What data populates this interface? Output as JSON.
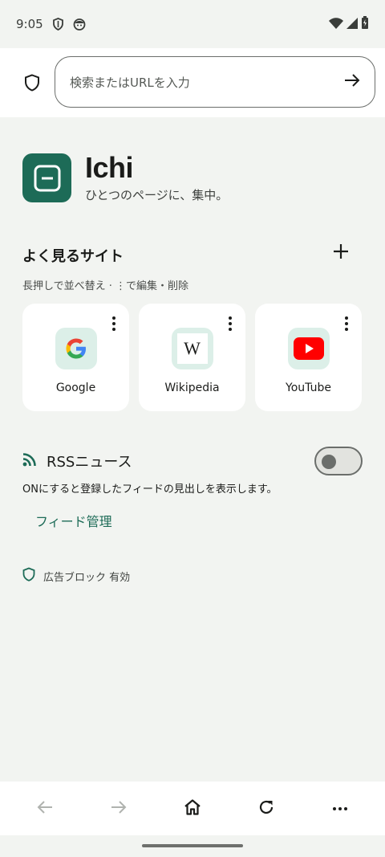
{
  "status": {
    "time": "9:05",
    "icons": [
      "shield-status-icon",
      "face-status-icon",
      "wifi-icon",
      "cell-signal-icon",
      "battery-icon"
    ]
  },
  "toolbar": {
    "search_placeholder": "検索またはURLを入力",
    "shield_icon": "shield-icon",
    "go_icon": "arrow-right-icon"
  },
  "brand": {
    "title": "Ichi",
    "subtitle": "ひとつのページに、集中。",
    "accent_color": "#1d6b57"
  },
  "top_sites": {
    "title": "よく見るサイト",
    "hint": "長押しで並べ替え · ⋮で編集・削除",
    "add_icon": "plus-icon",
    "items": [
      {
        "label": "Google",
        "icon": "google-g-icon"
      },
      {
        "label": "Wikipedia",
        "icon": "wikipedia-w-icon",
        "icon_text": "W"
      },
      {
        "label": "YouTube",
        "icon": "youtube-play-icon"
      }
    ]
  },
  "rss": {
    "title": "RSSニュース",
    "icon": "rss-icon",
    "enabled": false,
    "description": "ONにすると登録したフィードの見出しを表示します。",
    "manage_link": "フィード管理"
  },
  "adblock": {
    "text": "広告ブロック 有効",
    "icon": "shield-icon"
  },
  "bottom_nav": {
    "items": [
      "back-icon",
      "forward-icon",
      "home-icon",
      "reload-icon",
      "more-icon"
    ]
  }
}
